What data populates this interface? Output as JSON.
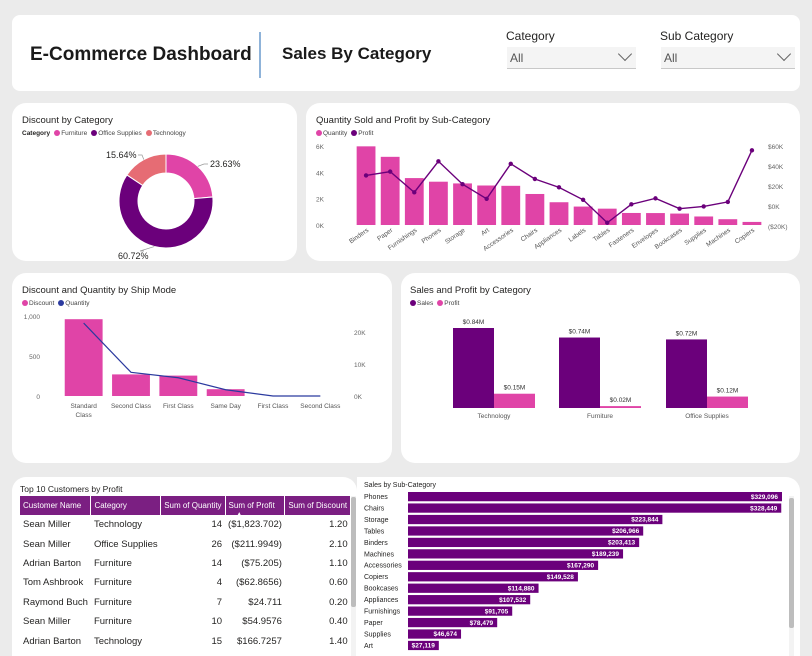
{
  "header": {
    "title": "E-Commerce Dashboard",
    "subtitle": "Sales By Category"
  },
  "slicers": {
    "category": {
      "label": "Category",
      "value": "All"
    },
    "sub_category": {
      "label": "Sub Category",
      "value": "All"
    }
  },
  "colors": {
    "furniture": "#e044a7",
    "office_supplies": "#6b007b",
    "technology": "#e66c74",
    "quantity_bar": "#e044a7",
    "profit_line": "#6b007b",
    "ship_line": "#2b3a9f",
    "accent_purple": "#7b1f82"
  },
  "discount_chart": {
    "title": "Discount by Category",
    "legend_title": "Category",
    "legend": [
      "Furniture",
      "Office Supplies",
      "Technology"
    ]
  },
  "qty_profit_chart": {
    "title": "Quantity Sold and Profit by Sub-Category",
    "legend": [
      "Quantity",
      "Profit"
    ],
    "y_left_ticks": [
      "6K",
      "4K",
      "2K",
      "0K"
    ],
    "y_right_ticks": [
      "$60K",
      "$40K",
      "$20K",
      "$0K",
      "($20K)"
    ]
  },
  "ship_chart": {
    "title": "Discount and Quantity by Ship Mode",
    "legend": [
      "Discount",
      "Quantity"
    ],
    "y_left_ticks": [
      "1,000",
      "500",
      "0"
    ],
    "y_right_ticks": [
      "20K",
      "10K",
      "0K"
    ],
    "x_labels": [
      "Standard Class",
      "Second Class",
      "First Class",
      "Same Day",
      "First Class",
      "Second Class"
    ]
  },
  "sales_profit_chart": {
    "title": "Sales and Profit by Category",
    "legend": [
      "Sales",
      "Profit"
    ]
  },
  "top_customers": {
    "title": "Top 10 Customers by Profit",
    "columns": [
      "Customer Name",
      "Category",
      "Sum of Quantity",
      "Sum of Profit",
      "Sum of Discount"
    ],
    "rows": [
      [
        "Sean Miller",
        "Technology",
        "14",
        "($1,823.702)",
        "1.20"
      ],
      [
        "Sean Miller",
        "Office Supplies",
        "26",
        "($211.9949)",
        "2.10"
      ],
      [
        "Adrian Barton",
        "Furniture",
        "14",
        "($75.205)",
        "1.10"
      ],
      [
        "Tom Ashbrook",
        "Furniture",
        "4",
        "($62.8656)",
        "0.60"
      ],
      [
        "Raymond Buch",
        "Furniture",
        "7",
        "$24.711",
        "0.20"
      ],
      [
        "Sean Miller",
        "Furniture",
        "10",
        "$54.9576",
        "0.40"
      ],
      [
        "Adrian Barton",
        "Technology",
        "15",
        "$166.7257",
        "1.40"
      ]
    ]
  },
  "sales_subcat_chart": {
    "title": "Sales by Sub-Category"
  },
  "chart_data": [
    {
      "type": "pie",
      "title": "Discount by Category",
      "categories": [
        "Office Supplies",
        "Furniture",
        "Technology"
      ],
      "values": [
        60.72,
        23.63,
        15.64
      ],
      "labels": [
        "60.72%",
        "23.63%",
        "15.64%"
      ],
      "legend": "top-left"
    },
    {
      "type": "bar",
      "title": "Quantity Sold and Profit by Sub-Category",
      "categories": [
        "Binders",
        "Paper",
        "Furnishings",
        "Phones",
        "Storage",
        "Art",
        "Accessories",
        "Chairs",
        "Appliances",
        "Labels",
        "Tables",
        "Fasteners",
        "Envelopes",
        "Bookcases",
        "Supplies",
        "Machines",
        "Copiers"
      ],
      "series": [
        {
          "name": "Quantity",
          "type": "bar",
          "axis": "left",
          "values": [
            5974,
            5178,
            3563,
            3289,
            3158,
            3000,
            2976,
            2356,
            1729,
            1400,
            1241,
            914,
            906,
            868,
            647,
            440,
            234
          ]
        },
        {
          "name": "Profit",
          "type": "line",
          "axis": "right",
          "values": [
            30222,
            34054,
            13059,
            44516,
            21279,
            6528,
            41937,
            26590,
            18138,
            5546,
            -17725,
            950,
            6964,
            -3473,
            -1189,
            3385,
            55618
          ]
        }
      ],
      "ylim_left": [
        0,
        6000
      ],
      "ylim_right": [
        -20000,
        60000
      ],
      "legend": "top-left"
    },
    {
      "type": "bar",
      "title": "Discount and Quantity by Ship Mode",
      "categories": [
        "Standard Class",
        "Second Class",
        "First Class",
        "Same Day",
        "First Class",
        "Second Class"
      ],
      "series": [
        {
          "name": "Discount",
          "type": "bar",
          "axis": "left",
          "values": [
            960,
            270,
            255,
            85,
            0,
            0
          ]
        },
        {
          "name": "Quantity",
          "type": "line",
          "axis": "right",
          "values": [
            22800,
            7400,
            5700,
            1960,
            0,
            0
          ]
        }
      ],
      "ylim_left": [
        0,
        1000
      ],
      "ylim_right": [
        0,
        25000
      ],
      "legend": "top-left"
    },
    {
      "type": "bar",
      "title": "Sales and Profit by Category",
      "categories": [
        "Technology",
        "Furniture",
        "Office Supplies"
      ],
      "series": [
        {
          "name": "Sales",
          "values": [
            0.84,
            0.74,
            0.72
          ],
          "labels": [
            "$0.84M",
            "$0.74M",
            "$0.72M"
          ]
        },
        {
          "name": "Profit",
          "values": [
            0.15,
            0.02,
            0.12
          ],
          "labels": [
            "$0.15M",
            "$0.02M",
            "$0.12M"
          ]
        }
      ],
      "legend": "top-left"
    },
    {
      "type": "bar",
      "orientation": "horizontal",
      "title": "Sales by Sub-Category",
      "categories": [
        "Phones",
        "Chairs",
        "Storage",
        "Tables",
        "Binders",
        "Machines",
        "Accessories",
        "Copiers",
        "Bookcases",
        "Appliances",
        "Furnishings",
        "Paper",
        "Supplies",
        "Art"
      ],
      "values": [
        329096,
        328449,
        223844,
        206966,
        203413,
        189239,
        167290,
        149528,
        114880,
        107532,
        91705,
        78479,
        46674,
        27119
      ],
      "labels": [
        "$329,096",
        "$328,449",
        "$223,844",
        "$206,966",
        "$203,413",
        "$189,239",
        "$167,290",
        "$149,528",
        "$114,880",
        "$107,532",
        "$91,705",
        "$78,479",
        "$46,674",
        "$27,119"
      ]
    }
  ]
}
